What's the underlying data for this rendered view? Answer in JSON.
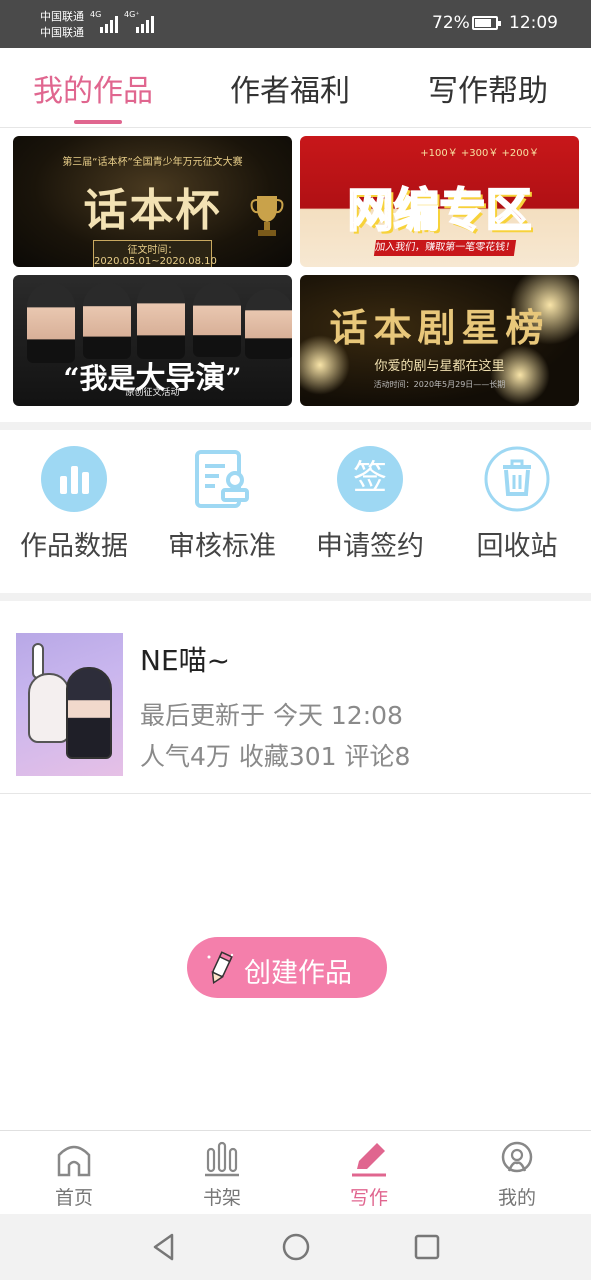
{
  "status_bar": {
    "carrier_1": "中国联通",
    "carrier_2": "中国联通",
    "sim1_type": "4G",
    "sim2_type": "4G⁺",
    "battery_percent": "72%",
    "battery_level": 0.72,
    "time": "12:09"
  },
  "tabs": [
    {
      "label": "我的作品",
      "active": true
    },
    {
      "label": "作者福利",
      "active": false
    },
    {
      "label": "写作帮助",
      "active": false
    }
  ],
  "banners": {
    "b1": {
      "subtitle": "第三届“话本杯”全国青少年万元征文大赛",
      "title": "话本杯",
      "date": "征文时间：2020.05.01~2020.08.10"
    },
    "b2": {
      "title": "网编专区",
      "money": "+100￥ +300￥ +200￥",
      "strip": "加入我们，赚取第一笔零花钱！"
    },
    "b3": {
      "quote_open": "“我是",
      "big": "大导演",
      "quote_close": "”",
      "sub": "原创征文活动"
    },
    "b4": {
      "title": "话本剧星榜",
      "sub": "你爱的剧与星都在这里",
      "small": "活动时间：2020年5月29日——长期"
    }
  },
  "quick_actions": [
    {
      "label": "作品数据",
      "icon": "bar-chart-icon"
    },
    {
      "label": "审核标准",
      "icon": "document-stamp-icon"
    },
    {
      "label": "申请签约",
      "icon": "sign-icon",
      "glyph": "签"
    },
    {
      "label": "回收站",
      "icon": "trash-icon"
    }
  ],
  "work": {
    "title": "NE喵~",
    "updated": "最后更新于 今天 12:08",
    "stats": "人气4万 收藏301 评论8"
  },
  "create_button": {
    "label": "创建作品"
  },
  "bottom_nav": [
    {
      "label": "首页",
      "icon": "home-icon",
      "active": false
    },
    {
      "label": "书架",
      "icon": "bookshelf-icon",
      "active": false
    },
    {
      "label": "写作",
      "icon": "pen-icon",
      "active": true
    },
    {
      "label": "我的",
      "icon": "profile-icon",
      "active": false
    }
  ],
  "colors": {
    "accent": "#e0668f",
    "action_icon": "#9ed8f3",
    "create_button": "#f47fab"
  }
}
